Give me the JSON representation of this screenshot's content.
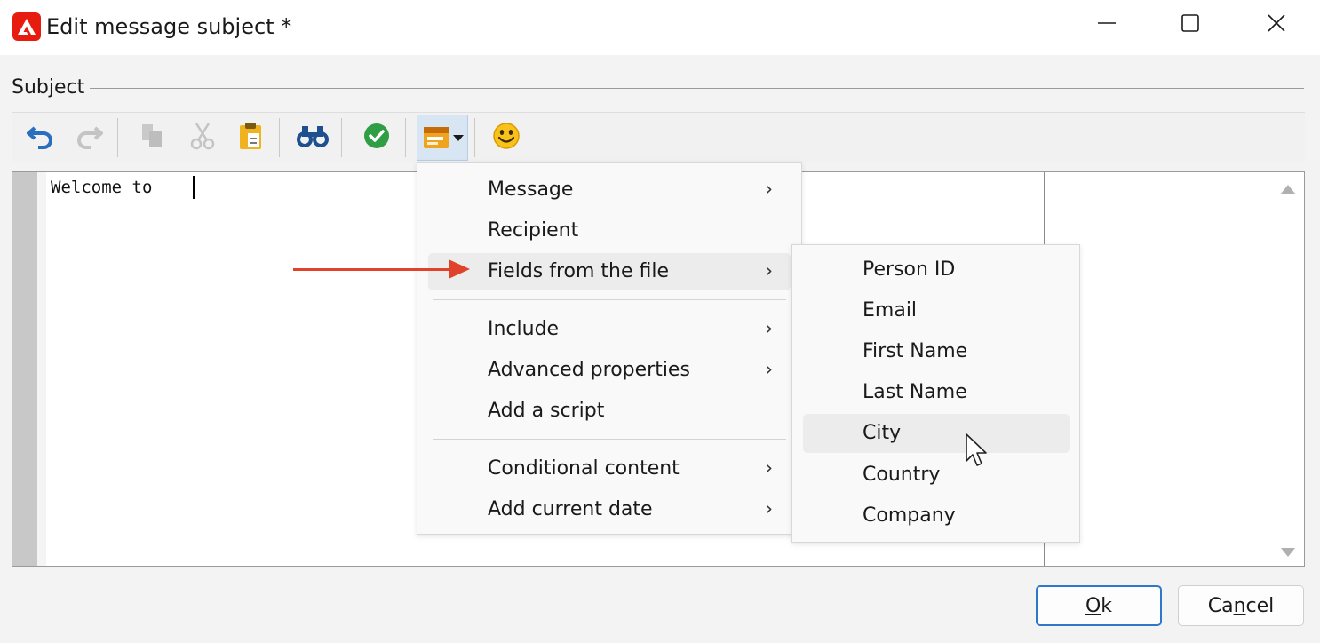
{
  "window": {
    "title": "Edit message subject *",
    "minimize_icon": "minimize-icon",
    "maximize_icon": "maximize-icon",
    "close_icon": "close-icon"
  },
  "subject": {
    "legend": "Subject",
    "editor_text": "Welcome to "
  },
  "toolbar": {
    "buttons": [
      {
        "name": "undo",
        "icon": "undo-icon",
        "enabled": true
      },
      {
        "name": "redo",
        "icon": "redo-icon",
        "enabled": false
      },
      {
        "name": "copy",
        "icon": "copy-icon",
        "enabled": false
      },
      {
        "name": "cut",
        "icon": "cut-icon",
        "enabled": false
      },
      {
        "name": "paste",
        "icon": "paste-icon",
        "enabled": true
      },
      {
        "name": "find",
        "icon": "binoculars-icon",
        "enabled": true
      },
      {
        "name": "validate",
        "icon": "check-circle-icon",
        "enabled": true
      },
      {
        "name": "insert",
        "icon": "insert-field-icon",
        "enabled": true,
        "has_dropdown": true
      },
      {
        "name": "emoji",
        "icon": "smiley-icon",
        "enabled": true
      }
    ]
  },
  "menu": {
    "items": [
      {
        "label": "Message",
        "submenu": true
      },
      {
        "label": "Recipient",
        "submenu": false
      },
      {
        "label": "Fields from the file",
        "submenu": true,
        "highlighted": true
      },
      {
        "label": "Include",
        "submenu": true
      },
      {
        "label": "Advanced properties",
        "submenu": true
      },
      {
        "label": "Add a script",
        "submenu": false
      },
      {
        "label": "Conditional content",
        "submenu": true
      },
      {
        "label": "Add current date",
        "submenu": true
      }
    ],
    "chevron": "›"
  },
  "submenu": {
    "items": [
      {
        "label": "Person ID"
      },
      {
        "label": "Email"
      },
      {
        "label": "First Name"
      },
      {
        "label": "Last Name"
      },
      {
        "label": "City",
        "highlighted": true
      },
      {
        "label": "Country"
      },
      {
        "label": "Company"
      }
    ]
  },
  "buttons": {
    "ok_u": "O",
    "ok_rest": "k",
    "cancel_pre": "Ca",
    "cancel_u": "n",
    "cancel_post": "cel"
  },
  "colors": {
    "app_icon": "#e81c0e",
    "annotation_arrow": "#e0432b",
    "ok_border": "#2d78c8"
  }
}
